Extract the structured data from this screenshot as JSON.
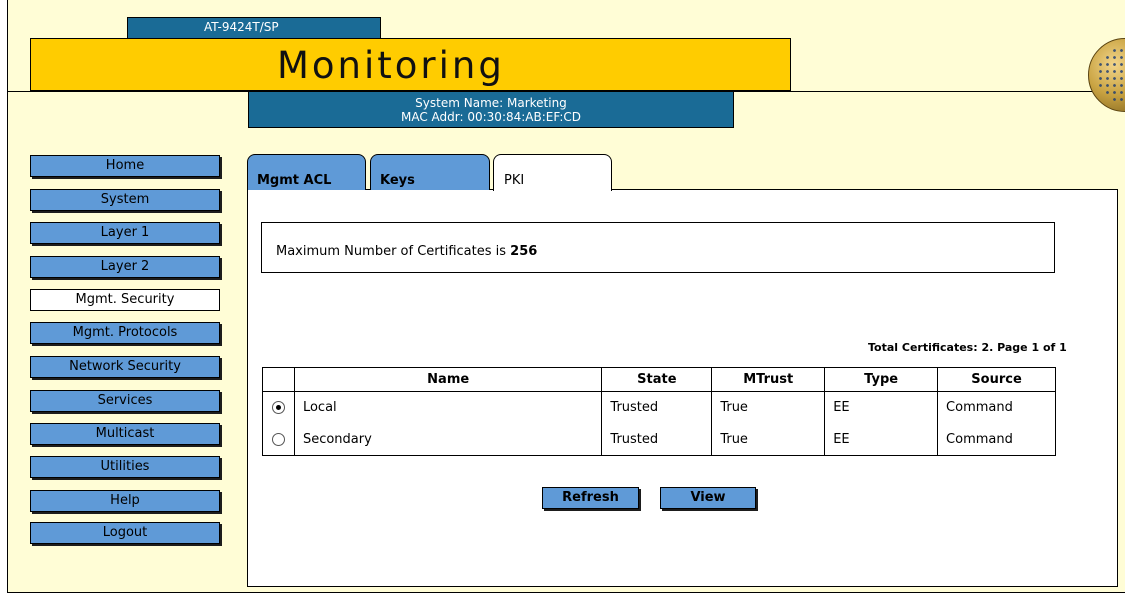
{
  "header": {
    "model": "AT-9424T/SP",
    "title": "Monitoring",
    "system_name": "System Name: Marketing",
    "mac_addr": "MAC Addr: 00:30:84:AB:EF:CD"
  },
  "sidebar": {
    "items": [
      {
        "label": "Home"
      },
      {
        "label": "System"
      },
      {
        "label": "Layer 1"
      },
      {
        "label": "Layer 2"
      },
      {
        "label": "Mgmt. Security",
        "active": true
      },
      {
        "label": "Mgmt. Protocols"
      },
      {
        "label": "Network Security"
      },
      {
        "label": "Services"
      },
      {
        "label": "Multicast"
      },
      {
        "label": "Utilities"
      },
      {
        "label": "Help"
      },
      {
        "label": "Logout"
      }
    ]
  },
  "tabs": [
    {
      "label": "Mgmt ACL"
    },
    {
      "label": "Keys"
    },
    {
      "label": "PKI",
      "active": true
    }
  ],
  "pki": {
    "max_prefix": "Maximum Number of Certificates is ",
    "max_value": "256",
    "total_text": "Total Certificates: 2. Page 1 of 1",
    "columns": [
      "Name",
      "State",
      "MTrust",
      "Type",
      "Source"
    ],
    "rows": [
      {
        "name": "Local",
        "state": "Trusted",
        "mtrust": "True",
        "type": "EE",
        "source": "Command",
        "selected": true
      },
      {
        "name": "Secondary",
        "state": "Trusted",
        "mtrust": "True",
        "type": "EE",
        "source": "Command",
        "selected": false
      }
    ],
    "refresh_label": "Refresh",
    "view_label": "View"
  },
  "colors": {
    "accent_blue": "#5f9ad7",
    "header_blue": "#1a6b96",
    "title_yellow": "#ffcc00",
    "background": "#fffdd6"
  }
}
